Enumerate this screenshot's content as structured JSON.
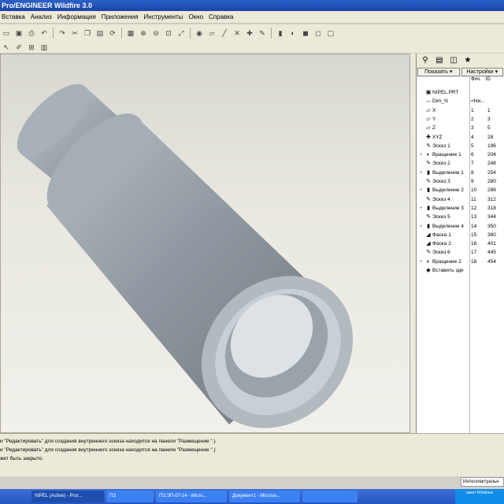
{
  "window": {
    "title": "Pro/ENGINEER Wildfire 3.0"
  },
  "menu": [
    "Вставка",
    "Анализ",
    "Информация",
    "Приложения",
    "Инструменты",
    "Окно",
    "Справка"
  ],
  "toolbar_row1": [
    "folder-icon",
    "save-icon",
    "print-icon",
    "undo-icon",
    "redo-icon",
    "cut-icon",
    "copy-icon",
    "paste-icon",
    "regenerate-icon",
    "repaint-icon",
    "zoom-in-icon",
    "zoom-out-icon",
    "refit-icon",
    "orient-icon",
    "view-icon",
    "datum-plane-icon",
    "datum-axis-icon",
    "datum-point-icon",
    "coordsys-icon",
    "sketch-icon",
    "extrude-icon",
    "revolve-icon",
    "shade-icon",
    "wireframe-icon",
    "hidden-icon"
  ],
  "toolbar_row2": [
    "select-icon",
    "sketch-tool-icon",
    "grid-icon",
    "table-icon"
  ],
  "model_panel": {
    "tabs": [
      "tree-tab-icon",
      "folder-tab-icon",
      "layer-tab-icon",
      "favorites-tab-icon"
    ],
    "show_label": "Показать ▾",
    "settings_label": "Настройки ▾",
    "col1": "Фич.",
    "col2": "ID",
    "items": [
      {
        "name": "NIPEL.PRT",
        "c1": "",
        "c2": "",
        "icon": "part-icon",
        "exp": ""
      },
      {
        "name": "Dim_N",
        "c1": "<Ни...",
        "c2": "",
        "icon": "dimension-icon",
        "exp": ""
      },
      {
        "name": "X",
        "c1": "1",
        "c2": "1",
        "icon": "datum-plane-icon",
        "exp": ""
      },
      {
        "name": "Y",
        "c1": "2",
        "c2": "3",
        "icon": "datum-plane-icon",
        "exp": ""
      },
      {
        "name": "Z",
        "c1": "3",
        "c2": "5",
        "icon": "datum-plane-icon",
        "exp": ""
      },
      {
        "name": "XYZ",
        "c1": "4",
        "c2": "28",
        "icon": "coordsys-icon",
        "exp": ""
      },
      {
        "name": "Эскиз 1",
        "c1": "5",
        "c2": "196",
        "icon": "sketch-icon",
        "exp": ""
      },
      {
        "name": "Вращение 1",
        "c1": "6",
        "c2": "204",
        "icon": "revolve-icon",
        "exp": "+"
      },
      {
        "name": "Эскиз 2",
        "c1": "7",
        "c2": "248",
        "icon": "sketch-icon",
        "exp": ""
      },
      {
        "name": "Выделение 1",
        "c1": "8",
        "c2": "254",
        "icon": "extrude-icon",
        "exp": "+"
      },
      {
        "name": "Эскиз 3",
        "c1": "9",
        "c2": "280",
        "icon": "sketch-icon",
        "exp": ""
      },
      {
        "name": "Выделение 2",
        "c1": "10",
        "c2": "286",
        "icon": "extrude-icon",
        "exp": "+"
      },
      {
        "name": "Эскиз 4",
        "c1": "11",
        "c2": "312",
        "icon": "sketch-icon",
        "exp": ""
      },
      {
        "name": "Выделение 3",
        "c1": "12",
        "c2": "318",
        "icon": "extrude-icon",
        "exp": "+"
      },
      {
        "name": "Эскиз 5",
        "c1": "13",
        "c2": "344",
        "icon": "sketch-icon",
        "exp": ""
      },
      {
        "name": "Выделение 4",
        "c1": "14",
        "c2": "350",
        "icon": "extrude-icon",
        "exp": "+"
      },
      {
        "name": "Фаска 1",
        "c1": "15",
        "c2": "380",
        "icon": "chamfer-icon",
        "exp": ""
      },
      {
        "name": "Фаска 2",
        "c1": "16",
        "c2": "401",
        "icon": "chamfer-icon",
        "exp": ""
      },
      {
        "name": "Эскиз 6",
        "c1": "17",
        "c2": "445",
        "icon": "sketch-icon",
        "exp": ""
      },
      {
        "name": "Вращение 2",
        "c1": "18",
        "c2": "454",
        "icon": "revolve-icon",
        "exp": "+"
      },
      {
        "name": "Вставить зде",
        "c1": "",
        "c2": "",
        "icon": "insert-here-icon",
        "exp": ""
      }
    ]
  },
  "status_messages": [
    "и \"Редактировать\" для создания внутреннего эскиза находится на панели \"Размещение \".)",
    "и \"Редактировать\" для создания внутреннего эскиза находится на панели \"Размещение \".)",
    "жет быть закрыто."
  ],
  "smart_filter": "Интеллектуальн",
  "taskbar": {
    "items": [
      {
        "label": "NIPEL (Active) - Pro/...",
        "active": true
      },
      {
        "label": "ПЗ",
        "active": false
      },
      {
        "label": "ПЗ.ЭП-07-14 - Micro...",
        "active": false
      },
      {
        "label": "Документ1 - Microso...",
        "active": false
      },
      {
        "label": "",
        "active": false
      }
    ],
    "tray_text": "пакет Windows"
  }
}
